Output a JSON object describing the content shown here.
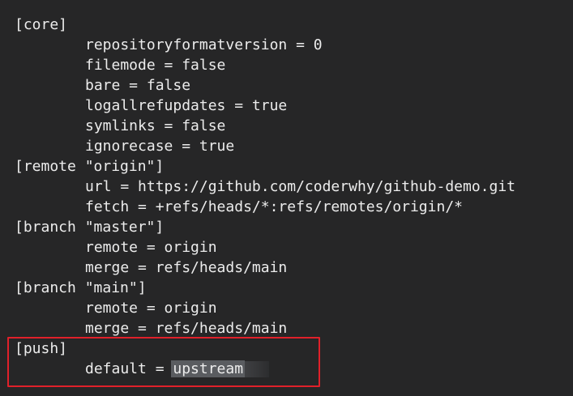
{
  "config": {
    "lines": [
      {
        "kind": "section",
        "text": "[core]"
      },
      {
        "kind": "entry",
        "text": "repositoryformatversion = 0"
      },
      {
        "kind": "entry",
        "text": "filemode = false"
      },
      {
        "kind": "entry",
        "text": "bare = false"
      },
      {
        "kind": "entry",
        "text": "logallrefupdates = true"
      },
      {
        "kind": "entry",
        "text": "symlinks = false"
      },
      {
        "kind": "entry",
        "text": "ignorecase = true"
      },
      {
        "kind": "section",
        "text": "[remote \"origin\"]"
      },
      {
        "kind": "entry",
        "text": "url = https://github.com/coderwhy/github-demo.git"
      },
      {
        "kind": "entry",
        "text": "fetch = +refs/heads/*:refs/remotes/origin/*"
      },
      {
        "kind": "section",
        "text": "[branch \"master\"]"
      },
      {
        "kind": "entry",
        "text": "remote = origin"
      },
      {
        "kind": "entry",
        "text": "merge = refs/heads/main"
      },
      {
        "kind": "section",
        "text": "[branch \"main\"]"
      },
      {
        "kind": "entry",
        "text": "remote = origin"
      },
      {
        "kind": "entry",
        "text": "merge = refs/heads/main"
      },
      {
        "kind": "section",
        "text": "[push]"
      }
    ],
    "push_default": {
      "key_text": "default = ",
      "value_text": "upstream"
    }
  },
  "colors": {
    "background": "#262627",
    "text": "#ececec",
    "highlight_border": "#e0202a",
    "selection": "#5a5c60"
  }
}
